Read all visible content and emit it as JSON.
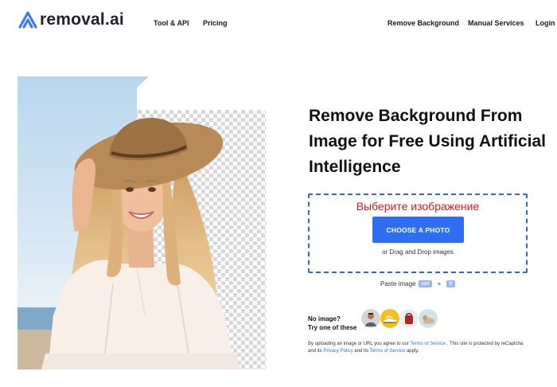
{
  "header": {
    "logo_text": "removal.ai",
    "nav_left": [
      "Tool & API",
      "Pricing"
    ],
    "nav_right": [
      "Remove Background",
      "Manual Services",
      "Login"
    ]
  },
  "hero": {
    "headline": "Remove Background From Image for Free Using Artificial Intelligence"
  },
  "upload": {
    "title": "Выберите изображение",
    "button_label": "CHOOSE A PHOTO",
    "drag_text": "or Drag and Drop images"
  },
  "paste": {
    "label": "Paste image",
    "key1": "ctrl",
    "plus": "+",
    "key2": "V"
  },
  "samples": {
    "line1": "No image?",
    "line2": "Try one of these",
    "items": [
      "sample-person",
      "sample-shoes",
      "sample-bag",
      "sample-dog"
    ]
  },
  "legal": {
    "t1": "By uploading an image or URL you agree to our ",
    "terms1": "Terms of Service",
    "t2": " . This site is protected by reCaptcha and its ",
    "privacy": "Privacy Policy",
    "t3": " and its ",
    "terms2": "Terms of Service",
    "t4": " apply."
  },
  "colors": {
    "accent": "#2f6ef3",
    "drop_border": "#2d6ae0",
    "drop_title": "#e01515"
  }
}
